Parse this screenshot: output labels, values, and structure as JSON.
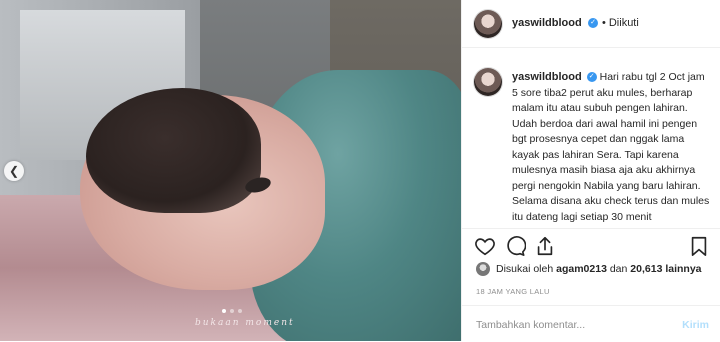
{
  "post": {
    "username": "yaswildblood",
    "follow_status": "Diikuti",
    "verified_badge": "verified-icon",
    "photo_watermark": "bukaan moment",
    "carousel": {
      "dots": 3,
      "active_index": 0
    },
    "caption_text": "Hari rabu tgl 2 Oct jam 5 sore tiba2 perut aku mules, berharap malam itu atau subuh pengen lahiran. Udah berdoa dari awal hamil ini pengen bgt prosesnya cepet dan nggak lama kayak pas lahiran Sera. Tapi karena mulesnya masih biasa aja aku akhirnya pergi nengokin Nabila yang baru lahiran. Selama disana aku check terus dan mules itu dateng lagi setiap 30 menit",
    "likes": {
      "prefix": "Disukai oleh",
      "first_user": "agam0213",
      "connector": "dan",
      "count_text": "20,613 lainnya"
    },
    "time_ago": "18 JAM YANG LALU"
  },
  "comment": {
    "placeholder": "Tambahkan komentar...",
    "send_label": "Kirim"
  },
  "icons": {
    "like": "heart-icon",
    "comment": "comment-icon",
    "share": "share-icon",
    "save": "bookmark-icon",
    "prev": "chevron-left-icon"
  },
  "colors": {
    "verified": "#3897f0",
    "send_disabled": "#b2dffc",
    "muted": "#8e8e8e",
    "border": "#efefef"
  }
}
